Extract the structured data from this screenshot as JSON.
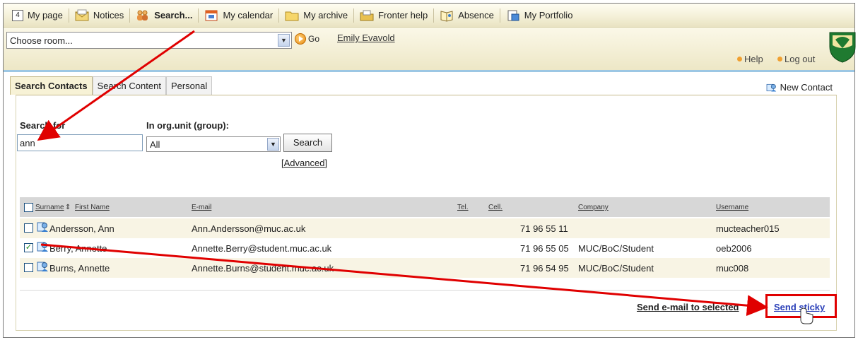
{
  "nav": {
    "items": [
      {
        "label": "My page",
        "icon": "calendar-4-icon",
        "badge": "4"
      },
      {
        "label": "Notices",
        "icon": "envelope-icon"
      },
      {
        "label": "Search...",
        "icon": "people-search-icon"
      },
      {
        "label": "My calendar",
        "icon": "calendar-icon"
      },
      {
        "label": "My archive",
        "icon": "folder-icon"
      },
      {
        "label": "Fronter help",
        "icon": "help-folder-icon"
      },
      {
        "label": "Absence",
        "icon": "book-icon"
      },
      {
        "label": "My Portfolio",
        "icon": "portfolio-icon"
      }
    ],
    "active_index": 2
  },
  "roombar": {
    "room_select": "Choose room...",
    "go_label": "Go",
    "user_name": "Emily Evavold",
    "help_label": "Help",
    "logout_label": "Log out"
  },
  "tabs": [
    {
      "label": "Search Contacts",
      "active": true
    },
    {
      "label": "Search Content",
      "active": false
    },
    {
      "label": "Personal",
      "active": false
    }
  ],
  "new_contact_label": "New Contact",
  "search": {
    "search_for_label": "Search for",
    "org_unit_label": "In org.unit (group):",
    "query_value": "ann",
    "org_value": "All",
    "search_button": "Search",
    "advanced_link": "[Advanced]"
  },
  "table": {
    "headers": {
      "surname": "Surname",
      "first_name": "First Name",
      "email": "E-mail",
      "tel": "Tel.",
      "cell": "Cell.",
      "company": "Company",
      "username": "Username"
    },
    "rows": [
      {
        "name": "Andersson, Ann",
        "email": "Ann.Andersson@muc.ac.uk",
        "tel": "",
        "cell": "71 96 55 11",
        "company": "",
        "username": "mucteacher015",
        "checked": false
      },
      {
        "name": "Berry, Annette",
        "email": "Annette.Berry@student.muc.ac.uk",
        "tel": "",
        "cell": "71 96 55 05",
        "company": "MUC/BoC/Student",
        "username": "oeb2006",
        "checked": true
      },
      {
        "name": "Burns, Annette",
        "email": "Annette.Burns@student.muc.ac.uk",
        "tel": "",
        "cell": "71 96 54 95",
        "company": "MUC/BoC/Student",
        "username": "muc008",
        "checked": false
      }
    ]
  },
  "actions": {
    "send_email": "Send e-mail to selected",
    "send_sticky": "Send sticky"
  },
  "colors": {
    "annotation_red": "#e00000",
    "accent_blue": "#9cc7e4",
    "link_blue": "#2a3fb8"
  }
}
